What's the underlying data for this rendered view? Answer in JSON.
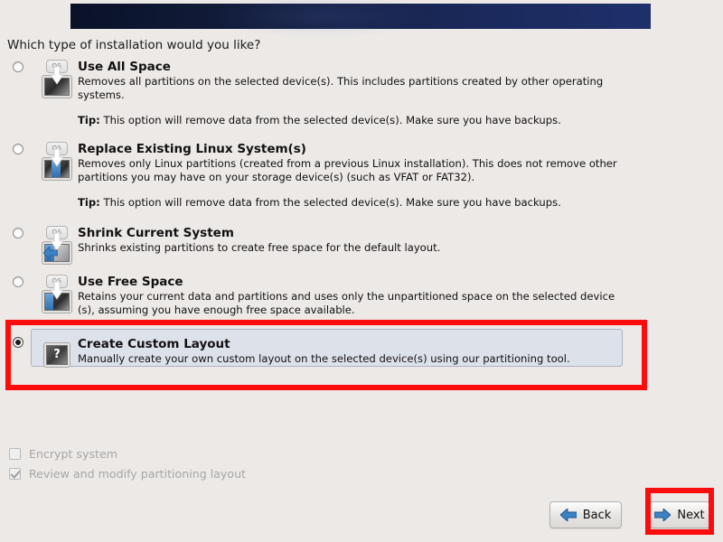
{
  "window": {
    "background_color": "#ece9e7",
    "banner": {
      "name": "installer-banner",
      "gradient_from": "#0a1228",
      "gradient_to": "#1e2f6b"
    }
  },
  "question": "Which type of installation would you like?",
  "options": [
    {
      "title": "Use All Space",
      "desc": "Removes all partitions on the selected device(s).  This includes partitions created by other operating systems.",
      "tip_label": "Tip:",
      "tip": " This option will remove data from the selected device(s).  Make sure you have backups.",
      "icon": "disk-use-all-space-icon",
      "os_label": "OS",
      "selected": false
    },
    {
      "title": "Replace Existing Linux System(s)",
      "desc": "Removes only Linux partitions (created from a previous Linux installation).  This does not remove other partitions you may have on your storage device(s) (such as VFAT or FAT32).",
      "tip_label": "Tip:",
      "tip": " This option will remove data from the selected device(s).  Make sure you have backups.",
      "icon": "disk-replace-linux-icon",
      "os_label": "OS",
      "selected": false
    },
    {
      "title": "Shrink Current System",
      "desc": "Shrinks existing partitions to create free space for the default layout.",
      "tip_label": "",
      "tip": "",
      "icon": "disk-shrink-icon",
      "os_label": "OS",
      "selected": false
    },
    {
      "title": "Use Free Space",
      "desc": "Retains your current data and partitions and uses only the unpartitioned space on the selected device (s), assuming you have enough free space available.",
      "tip_label": "",
      "tip": "",
      "icon": "disk-free-space-icon",
      "os_label": "OS",
      "selected": false
    },
    {
      "title": "Create Custom Layout",
      "desc": "Manually create your own custom layout on the selected device(s) using our partitioning tool.",
      "tip_label": "",
      "tip": "",
      "icon": "question-mark-disk-icon",
      "os_label": "?",
      "selected": true
    }
  ],
  "checkboxes": [
    {
      "label": "Encrypt system",
      "checked": false,
      "disabled": true
    },
    {
      "label": "Review and modify partitioning layout",
      "checked": true,
      "disabled": true
    }
  ],
  "buttons": {
    "back": {
      "label": "Back",
      "icon": "arrow-left-icon"
    },
    "next": {
      "label": "Next",
      "icon": "arrow-right-icon"
    }
  },
  "annotations": {
    "color": "#fb0d0d",
    "custom_layout_highlight": "create-custom-layout-row",
    "next_highlight": "next-button"
  }
}
